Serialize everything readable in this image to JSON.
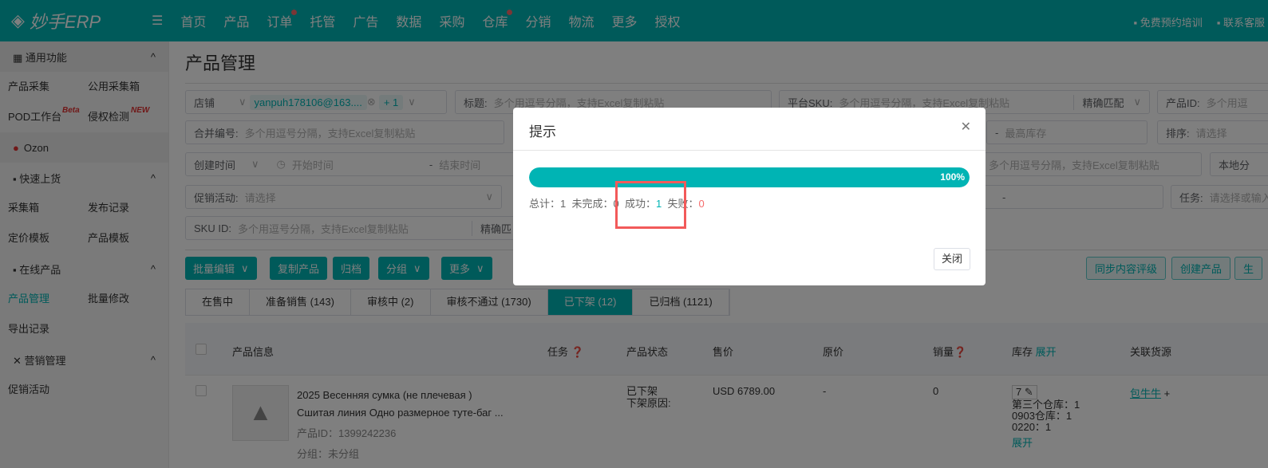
{
  "header": {
    "logo": "妙手ERP",
    "nav": [
      "首页",
      "产品",
      "订单",
      "托管",
      "广告",
      "数据",
      "采购",
      "仓库",
      "分销",
      "物流",
      "更多",
      "授权"
    ],
    "training": "免费预约培训",
    "support": "联系客服"
  },
  "sidebar": {
    "general": "通用功能",
    "collect": "产品采集",
    "public_box": "公用采集箱",
    "pod": "POD工作台",
    "beta": "Beta",
    "infringe": "侵权检测",
    "new": "NEW",
    "ozon": "Ozon",
    "quick": "快速上货",
    "box": "采集箱",
    "publish": "发布记录",
    "price_tpl": "定价模板",
    "prod_tpl": "产品模板",
    "online": "在线产品",
    "manage": "产品管理",
    "batch": "批量修改",
    "export": "导出记录",
    "marketing": "营销管理",
    "promo": "促销活动"
  },
  "page": {
    "title": "产品管理"
  },
  "filters": {
    "store": "店铺",
    "store_tag": "yanpuh178106@163....",
    "plus": "+ 1",
    "title_label": "标题:",
    "multi_ph": "多个用逗号分隔，支持Excel复制粘贴",
    "sku_label": "平台SKU:",
    "exact": "精确匹配",
    "pid_label": "产品ID:",
    "pid_ph": "多个用逗",
    "merge_label": "合并编号:",
    "max_stock": "最高库存",
    "sort_label": "排序:",
    "select_ph": "请选择",
    "created": "创建时间",
    "start": "开始时间",
    "end": "结束时间",
    "local": "本地分",
    "promo_label": "促销活动:",
    "task_label": "任务:",
    "task_ph": "请选择或输入",
    "skuid_label": "SKU ID:",
    "exact_short": "精确匹",
    "dash": "-"
  },
  "toolbar": {
    "batch_edit": "批量编辑",
    "copy": "复制产品",
    "archive": "归档",
    "group": "分组",
    "more": "更多",
    "sync": "同步内容评级",
    "create": "创建产品",
    "gen": "生"
  },
  "tabs": [
    "在售中",
    "准备销售 (143)",
    "审核中 (2)",
    "审核不通过 (1730)",
    "已下架 (12)",
    "已归档 (1121)"
  ],
  "table": {
    "headers": [
      "产品信息",
      "任务",
      "产品状态",
      "售价",
      "原价",
      "销量",
      "库存",
      "展开",
      "关联货源"
    ],
    "row": {
      "title1": "2025 Весенняя сумка (не плечевая )",
      "title2": "Сшитая линия Одно размерное туте-баг ...",
      "pid": "产品ID：1399242236",
      "group": "分组：未分组",
      "status": "已下架",
      "reason": "下架原因:",
      "price": "USD 6789.00",
      "orig": "-",
      "sales": "0",
      "stock": "7",
      "wh1": "第三个仓库：1",
      "wh2": "0903仓库：1",
      "wh3": "0220：1",
      "expand": "展开",
      "source": "包牛牛"
    }
  },
  "modal": {
    "title": "提示",
    "progress": 100,
    "progress_label": "100%",
    "total_label": "总计：",
    "total": "1",
    "pending_label": "未完成：",
    "pending": "0",
    "success_label": "成功：",
    "success": "1",
    "fail_label": "失败：",
    "fail": "0",
    "close": "关闭"
  }
}
